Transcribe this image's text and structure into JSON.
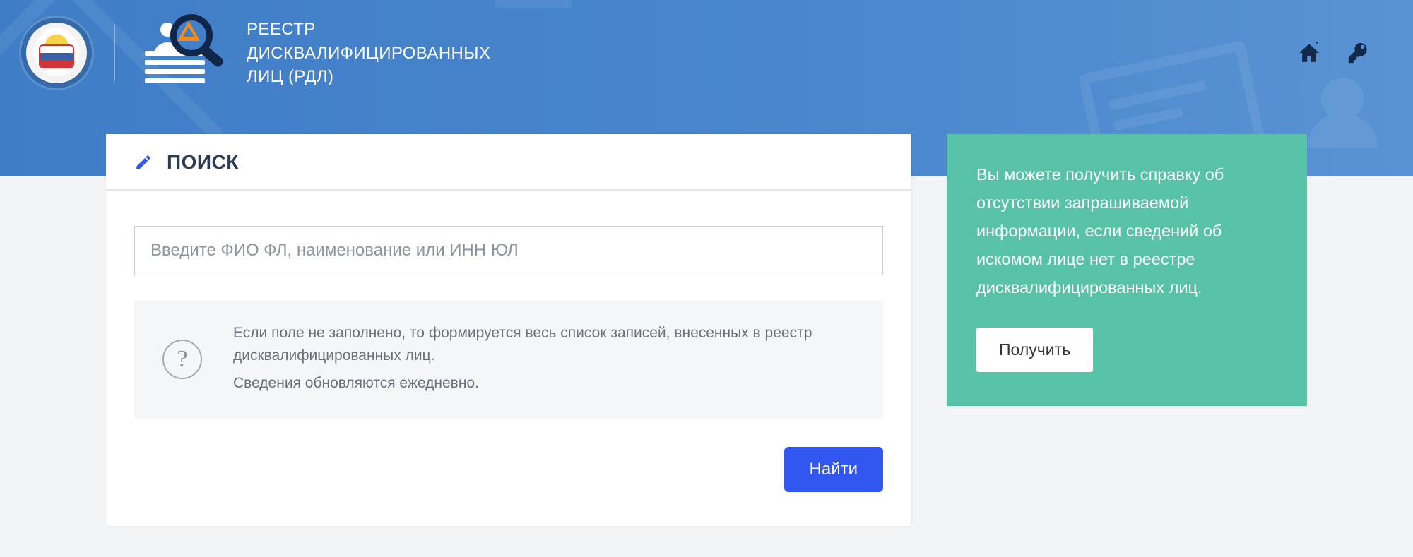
{
  "header": {
    "title": "РЕЕСТР\nДИСКВАЛИФИЦИРОВАННЫХ\nЛИЦ (РДЛ)"
  },
  "search": {
    "card_title": "ПОИСК",
    "placeholder": "Введите ФИО ФЛ, наименование или ИНН ЮЛ",
    "value": "",
    "note_line1": "Если поле не заполнено, то формируется весь список записей, внесенных в реестр дисквалифицированных лиц.",
    "note_line2": "Сведения обновляются ежедневно.",
    "submit_label": "Найти"
  },
  "side": {
    "text": "Вы можете получить справку об отсутствии запрашиваемой информации, если сведений об искомом лице нет в реестре дисквалифицированных лиц.",
    "button_label": "Получить"
  }
}
